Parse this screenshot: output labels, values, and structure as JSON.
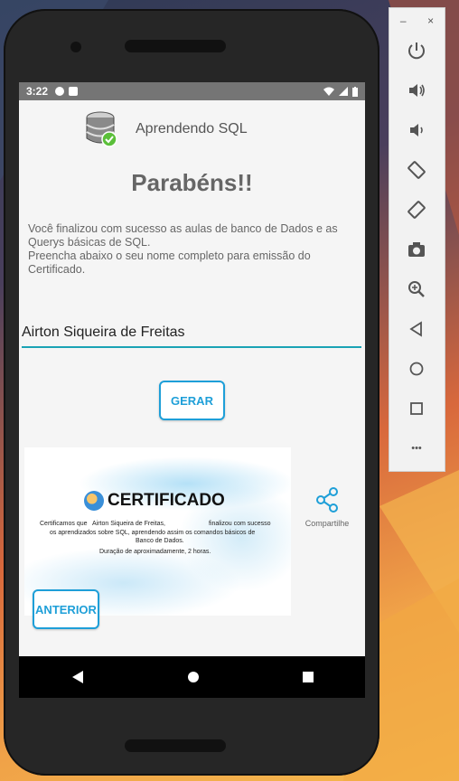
{
  "status": {
    "time": "3:22"
  },
  "app": {
    "title": "Aprendendo SQL"
  },
  "main": {
    "heading": "Parabéns!!",
    "description_1": "Você finalizou com sucesso as aulas de banco de Dados e as Querys básicas de SQL.",
    "description_2": "Preencha abaixo o seu nome completo para emissão do Certificado.",
    "name_value": "Airton Siqueira de Freitas",
    "gerar_label": "GERAR",
    "anterior_label": "ANTERIOR",
    "share_label": "Compartilhe"
  },
  "certificate": {
    "title": "CERTIFICADO",
    "line1_prefix": "Certificamos que",
    "line1_name": "Airton Siqueira de Freitas,",
    "line1_suffix": "finalizou com sucesso",
    "line2": "os aprendizados sobre SQL, aprendendo assim os comandos básicos de",
    "line3": "Banco de Dados.",
    "line4": "Duração de aproximadamente, 2 horas."
  },
  "emulator_panel": {
    "minimize": "–",
    "close": "×",
    "more": "•••"
  },
  "colors": {
    "accent": "#1e9fd8",
    "input_underline": "#1aa3b5"
  }
}
